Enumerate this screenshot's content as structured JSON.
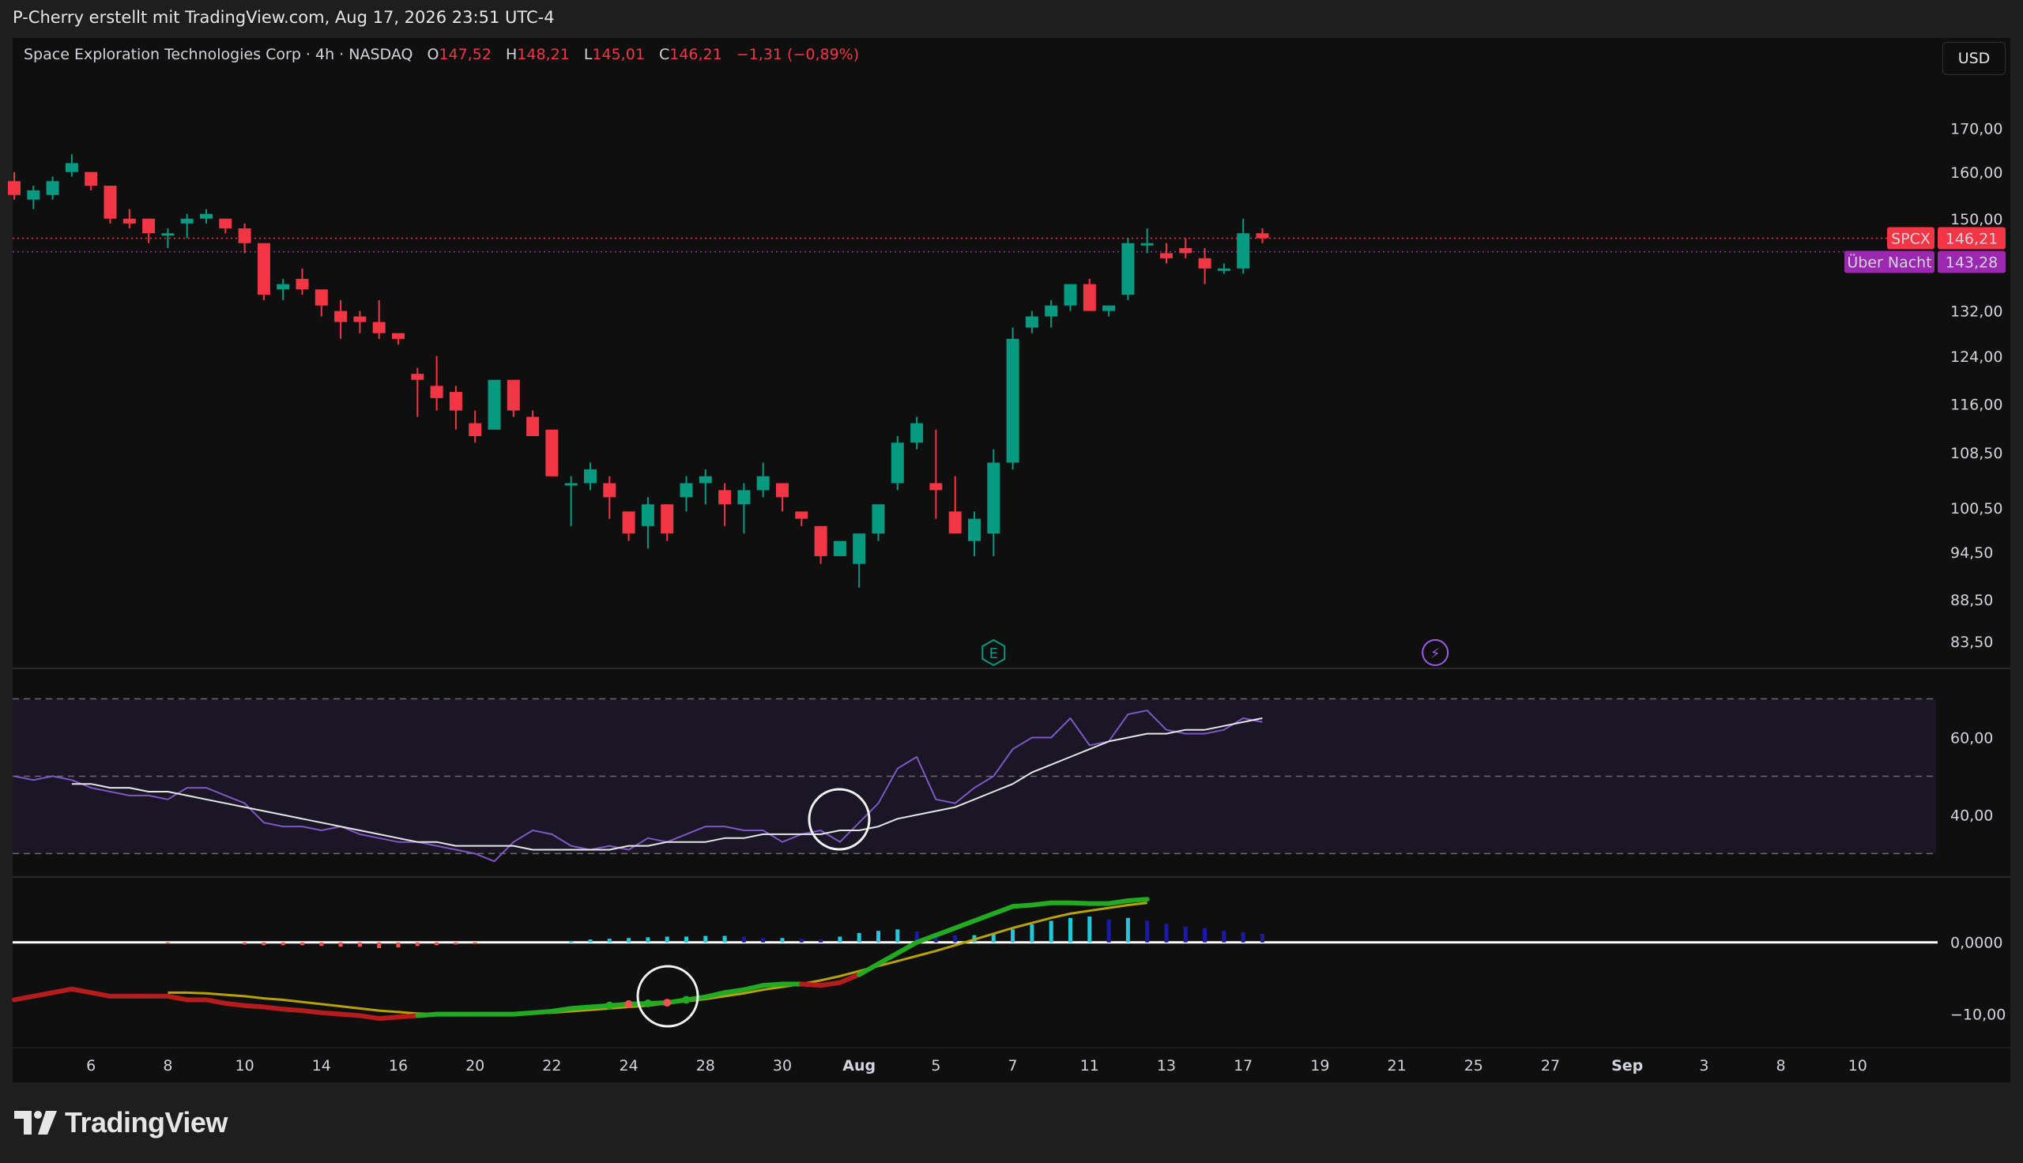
{
  "header": {
    "caption": "P-Cherry erstellt mit TradingView.com, Aug 17, 2026 23:51 UTC-4"
  },
  "legend": {
    "symbol": "Space Exploration Technologies Corp · 4h · NASDAQ",
    "open_label": "O",
    "open": "147,52",
    "high_label": "H",
    "high": "148,21",
    "low_label": "L",
    "low": "145,01",
    "close_label": "C",
    "close": "146,21",
    "change": "−1,31 (−0,89%)"
  },
  "currency_button": "USD",
  "price_tags": {
    "last": {
      "label": "SPCX",
      "value": "146,21",
      "color": "#f23645"
    },
    "overnight": {
      "label": "Über Nacht",
      "value": "143,28",
      "color": "#9c27b0"
    }
  },
  "event_markers": [
    {
      "icon": "earnings-icon",
      "glyph": "E",
      "date_index": 51,
      "color": "#089981"
    },
    {
      "icon": "lightning-icon",
      "glyph": "⚡",
      "date_index": 74,
      "color": "#9c5ce6"
    }
  ],
  "brand": {
    "name": "TradingView"
  },
  "colors": {
    "up": "#089981",
    "down": "#f23645",
    "rsi": "#7e57c2",
    "rsi_ma": "#e6e6e6",
    "macd_fast_up": "#22ab22",
    "macd_fast_down": "#b71c1c",
    "macd_signal": "#b5a20c",
    "hist_pos_strong": "#26c6da",
    "hist_pos_weak": "#1a1aa6",
    "hist_neg": "#ef5350"
  },
  "chart_data": [
    {
      "type": "candlestick",
      "title": "Space Exploration Technologies Corp · 4h · NASDAQ",
      "y_scale": "log",
      "y_ticks": [
        "170,00",
        "160,00",
        "150,00",
        "132,00",
        "124,00",
        "116,00",
        "108,50",
        "100,50",
        "94,50",
        "88,50",
        "83,50"
      ],
      "y_tick_values": [
        170,
        160,
        150,
        132,
        124,
        116,
        108.5,
        100.5,
        94.5,
        88.5,
        83.5
      ],
      "ylim": [
        81,
        182
      ],
      "x_tick_labels": [
        "6",
        "8",
        "10",
        "14",
        "16",
        "20",
        "22",
        "24",
        "28",
        "30",
        "Aug",
        "5",
        "7",
        "11",
        "13",
        "17",
        "19",
        "21",
        "25",
        "27",
        "Sep",
        "3",
        "8",
        "10"
      ],
      "x_tick_index": [
        4,
        8,
        12,
        16,
        20,
        24,
        28,
        32,
        36,
        40,
        44,
        48,
        52,
        56,
        60,
        64,
        68,
        72,
        76,
        80,
        84,
        88,
        92,
        96
      ],
      "candles": [
        [
          158,
          160,
          154,
          155
        ],
        [
          154,
          157,
          152,
          156
        ],
        [
          155,
          159,
          154,
          158
        ],
        [
          160,
          164,
          159,
          162
        ],
        [
          160,
          160,
          156,
          157
        ],
        [
          157,
          157,
          149,
          150
        ],
        [
          150,
          152,
          148,
          149
        ],
        [
          150,
          150,
          145,
          147
        ],
        [
          147,
          148,
          144,
          147
        ],
        [
          149,
          151,
          146,
          150
        ],
        [
          150,
          152,
          149,
          151
        ],
        [
          150,
          150,
          147,
          148
        ],
        [
          148,
          149,
          143,
          145
        ],
        [
          145,
          145,
          134,
          135
        ],
        [
          136,
          138,
          134,
          137
        ],
        [
          138,
          140,
          135,
          136
        ],
        [
          136,
          136,
          131,
          133
        ],
        [
          132,
          134,
          127,
          130
        ],
        [
          131,
          132,
          128,
          130
        ],
        [
          130,
          134,
          127,
          128
        ],
        [
          128,
          128,
          126,
          127
        ],
        [
          121,
          122,
          114,
          120
        ],
        [
          119,
          124,
          115,
          117
        ],
        [
          118,
          119,
          112,
          115
        ],
        [
          113,
          115,
          110,
          111
        ],
        [
          112,
          120,
          112,
          120
        ],
        [
          120,
          120,
          114,
          115
        ],
        [
          114,
          115,
          111,
          111
        ],
        [
          112,
          112,
          105,
          105
        ],
        [
          104,
          105,
          98,
          104
        ],
        [
          104,
          107,
          103,
          106
        ],
        [
          104,
          105,
          99,
          102
        ],
        [
          100,
          100,
          96,
          97
        ],
        [
          98,
          102,
          95,
          101
        ],
        [
          101,
          101,
          96,
          97
        ],
        [
          102,
          105,
          100,
          104
        ],
        [
          104,
          106,
          101,
          105
        ],
        [
          103,
          104,
          98,
          101
        ],
        [
          101,
          104,
          97,
          103
        ],
        [
          103,
          107,
          102,
          105
        ],
        [
          104,
          104,
          100,
          102
        ],
        [
          100,
          100,
          98,
          99
        ],
        [
          98,
          98,
          93,
          94
        ],
        [
          94,
          96,
          94,
          96
        ],
        [
          93,
          97,
          90,
          97
        ],
        [
          97,
          101,
          96,
          101
        ],
        [
          104,
          111,
          103,
          110
        ],
        [
          110,
          114,
          109,
          113
        ],
        [
          104,
          112,
          99,
          103
        ],
        [
          100,
          105,
          99,
          97
        ],
        [
          96,
          100,
          94,
          99
        ],
        [
          97,
          109,
          94,
          107
        ],
        [
          107,
          129,
          106,
          127
        ],
        [
          129,
          132,
          128,
          131
        ],
        [
          131,
          134,
          129,
          133
        ],
        [
          133,
          137,
          132,
          137
        ],
        [
          137,
          138,
          132,
          132
        ],
        [
          132,
          133,
          131,
          133
        ],
        [
          135,
          146,
          134,
          145
        ],
        [
          145,
          148,
          143,
          145
        ],
        [
          143,
          145,
          141,
          142
        ],
        [
          144,
          146,
          142,
          143
        ],
        [
          142,
          144,
          137,
          140
        ],
        [
          140,
          141,
          139,
          140
        ],
        [
          140,
          150,
          139,
          147
        ],
        [
          147,
          148,
          145,
          146
        ]
      ]
    },
    {
      "type": "line",
      "title": "RSI",
      "y_ticks": [
        "60,00",
        "40,00"
      ],
      "y_tick_values": [
        60,
        40
      ],
      "ylim": [
        26,
        75
      ],
      "bands": [
        70,
        50,
        30
      ],
      "series": [
        {
          "values": [
            50,
            49,
            50,
            49,
            47,
            46,
            45,
            45,
            44,
            47,
            47,
            45,
            43,
            38,
            37,
            37,
            36,
            37,
            35,
            34,
            33,
            33,
            32,
            31,
            30,
            28,
            33,
            36,
            35,
            32,
            31,
            32,
            31,
            34,
            33,
            35,
            37,
            37,
            36,
            36,
            33,
            35,
            36,
            33,
            38,
            43,
            52,
            55,
            44,
            43,
            47,
            50,
            57,
            60,
            60,
            65,
            58,
            59,
            66,
            67,
            62,
            61,
            61,
            62,
            65,
            64
          ]
        },
        {
          "values": [
            null,
            null,
            null,
            48,
            48,
            47,
            47,
            46,
            46,
            45,
            44,
            43,
            42,
            41,
            40,
            39,
            38,
            37,
            36,
            35,
            34,
            33,
            33,
            32,
            32,
            32,
            32,
            31,
            31,
            31,
            31,
            31,
            32,
            32,
            33,
            33,
            33,
            34,
            34,
            35,
            35,
            35,
            35,
            36,
            36,
            37,
            39,
            40,
            41,
            42,
            44,
            46,
            48,
            51,
            53,
            55,
            57,
            59,
            60,
            61,
            61,
            62,
            62,
            63,
            64,
            65
          ]
        }
      ]
    },
    {
      "type": "line",
      "title": "MACD",
      "y_ticks": [
        "0,0000",
        "−10,00"
      ],
      "y_tick_values": [
        0,
        -10
      ],
      "ylim": [
        -14,
        8
      ],
      "series": [
        {
          "values": [
            -8,
            -7.5,
            -7,
            -6.5,
            -7,
            -7.5,
            -7.5,
            -7.5,
            -7.5,
            -8,
            -8,
            -8.5,
            -8.8,
            -9,
            -9.3,
            -9.5,
            -9.8,
            -10,
            -10.2,
            -10.6,
            -10.4,
            -10.2,
            -10,
            -10,
            -10,
            -10,
            -10,
            -9.8,
            -9.6,
            -9.2,
            -9,
            -8.8,
            -8.6,
            -8.5,
            -8.4,
            -8,
            -7.6,
            -7,
            -6.6,
            -6,
            -5.8,
            -5.8,
            -6,
            -5.6,
            -4.5,
            -3,
            -1.5,
            0,
            1,
            2,
            3,
            4,
            5,
            5.2,
            5.5,
            5.5,
            5.4,
            5.4,
            5.8,
            6
          ]
        },
        {
          "values": [
            null,
            null,
            null,
            null,
            null,
            null,
            null,
            null,
            -7,
            -7,
            -7.1,
            -7.3,
            -7.5,
            -7.8,
            -8,
            -8.3,
            -8.6,
            -8.9,
            -9.2,
            -9.5,
            -9.7,
            -9.9,
            -10,
            -10.1,
            -10.1,
            -10.1,
            -10,
            -9.9,
            -9.8,
            -9.6,
            -9.4,
            -9.2,
            -9,
            -8.8,
            -8.5,
            -8.2,
            -7.9,
            -7.5,
            -7.1,
            -6.6,
            -6.2,
            -5.8,
            -5.3,
            -4.7,
            -4,
            -3.3,
            -2.6,
            -1.9,
            -1.2,
            -0.4,
            0.4,
            1.2,
            2,
            2.7,
            3.4,
            4,
            4.4,
            4.8,
            5.2,
            5.5
          ]
        },
        {
          "values": [
            0,
            0,
            0,
            0,
            0,
            0,
            0,
            0,
            -0.2,
            0,
            0,
            0,
            -0.3,
            -0.4,
            -0.4,
            -0.4,
            -0.5,
            -0.6,
            -0.6,
            -0.8,
            -0.7,
            -0.5,
            -0.4,
            -0.3,
            -0.2,
            0,
            0,
            0,
            0,
            0.2,
            0.4,
            0.5,
            0.6,
            0.7,
            0.8,
            0.8,
            0.9,
            0.9,
            0.8,
            0.6,
            0.6,
            0.5,
            0.4,
            0.8,
            1.3,
            1.6,
            1.8,
            1.5,
            1.2,
            1.0,
            1.0,
            1.3,
            1.8,
            2.5,
            3.0,
            3.4,
            3.6,
            3.2,
            3.4,
            3.0,
            2.6,
            2.2,
            2.0,
            1.6,
            1.4,
            1.2
          ]
        }
      ]
    }
  ]
}
